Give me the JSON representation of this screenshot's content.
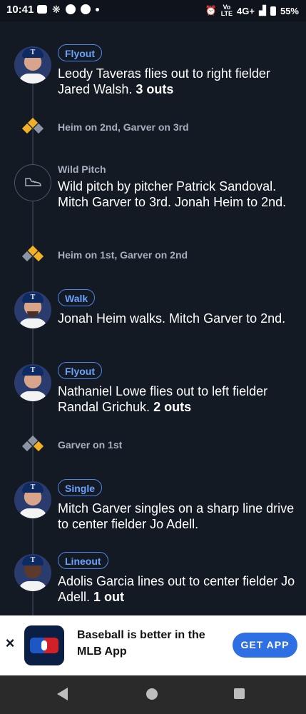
{
  "status_bar": {
    "time": "10:41",
    "network": "4G+",
    "volte_top": "Vo",
    "volte_bottom": "LTE",
    "battery": "55%"
  },
  "plays": [
    {
      "kind": "play",
      "badge": "Flyout",
      "text": "Leody Taveras flies out to right fielder Jared Walsh.",
      "outs": "3 outs"
    },
    {
      "kind": "runners",
      "text": "Heim on 2nd, Garver on 3rd"
    },
    {
      "kind": "event",
      "type": "Wild Pitch",
      "text": "Wild pitch by pitcher Patrick Sandoval. Mitch Garver to 3rd. Jonah Heim to 2nd."
    },
    {
      "kind": "runners",
      "text": "Heim on 1st, Garver on 2nd"
    },
    {
      "kind": "play",
      "badge": "Walk",
      "text": "Jonah Heim walks. Mitch Garver to 2nd.",
      "outs": ""
    },
    {
      "kind": "play",
      "badge": "Flyout",
      "text": "Nathaniel Lowe flies out to left fielder Randal Grichuk.",
      "outs": "2 outs"
    },
    {
      "kind": "runners",
      "text": "Garver on 1st"
    },
    {
      "kind": "play",
      "badge": "Single",
      "text": "Mitch Garver singles on a sharp line drive to center fielder Jo Adell.",
      "outs": ""
    },
    {
      "kind": "play",
      "badge": "Lineout",
      "text": "Adolis Garcia lines out to center fielder Jo Adell.",
      "outs": "1 out"
    }
  ],
  "team_cap_letter": "T",
  "app_banner": {
    "title": "Baseball is better in the MLB App",
    "button": "GET APP",
    "close": "×"
  },
  "colors": {
    "background": "#141a24",
    "accent": "#2f6fe4",
    "badge": "#6aa2ff",
    "runner_on_base": "#f2b124"
  }
}
